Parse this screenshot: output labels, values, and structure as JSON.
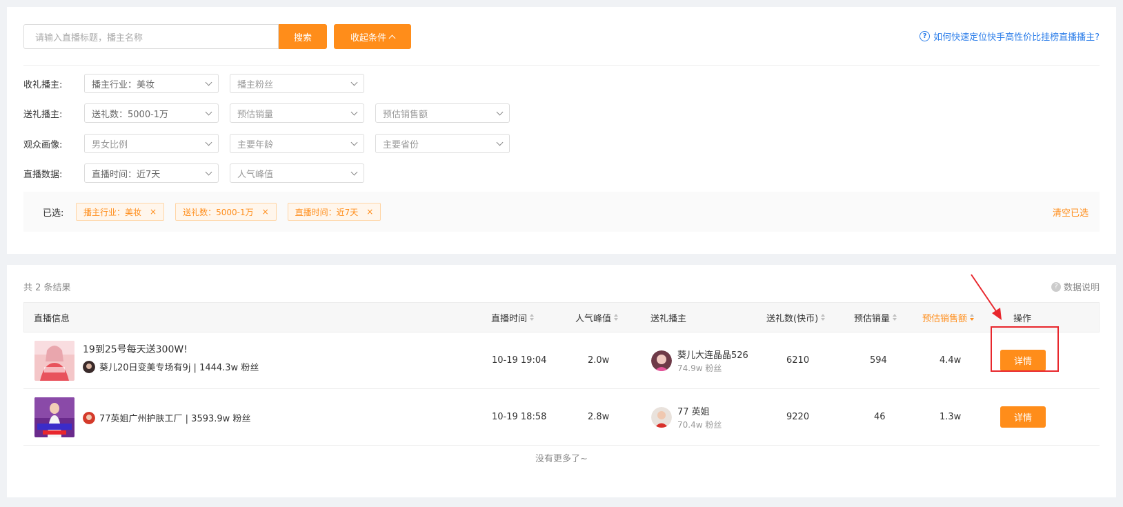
{
  "search": {
    "placeholder": "请输入直播标题，播主名称",
    "search_label": "搜索",
    "collapse_label": "收起条件"
  },
  "help": {
    "link_text": "如何快速定位快手高性价比挂榜直播播主?"
  },
  "filters": [
    {
      "label": "收礼播主:",
      "selects": [
        {
          "text": "播主行业：美妆",
          "active": true
        },
        {
          "text": "播主粉丝",
          "active": false
        }
      ]
    },
    {
      "label": "送礼播主:",
      "selects": [
        {
          "text": "送礼数：5000-1万",
          "active": true
        },
        {
          "text": "预估销量",
          "active": false
        },
        {
          "text": "预估销售额",
          "active": false
        }
      ]
    },
    {
      "label": "观众画像:",
      "selects": [
        {
          "text": "男女比例",
          "active": false
        },
        {
          "text": "主要年龄",
          "active": false
        },
        {
          "text": "主要省份",
          "active": false
        }
      ]
    },
    {
      "label": "直播数据:",
      "selects": [
        {
          "text": "直播时间：近7天",
          "active": true
        },
        {
          "text": "人气峰值",
          "active": false
        }
      ]
    }
  ],
  "selected": {
    "label": "已选:",
    "tags": [
      "播主行业：美妆",
      "送礼数：5000-1万",
      "直播时间：近7天"
    ],
    "remove_glyph": "×",
    "clear_label": "清空已选"
  },
  "results": {
    "count_text": "共 2 条结果",
    "data_note": "数据说明",
    "columns": {
      "info": "直播信息",
      "time": "直播时间",
      "peak": "人气峰值",
      "gifter": "送礼播主",
      "gifts": "送礼数(快币)",
      "sales": "预估销量",
      "revenue": "预估销售额",
      "action": "操作"
    },
    "rows": [
      {
        "title": "19到25号每天送300W!",
        "anchor": "葵儿20日变美专场有9j | 1444.3w 粉丝",
        "time": "10-19 19:04",
        "peak": "2.0w",
        "gifter_name": "葵儿大连晶晶526",
        "gifter_fans": "74.9w 粉丝",
        "gifts": "6210",
        "sales": "594",
        "revenue": "4.4w",
        "action": "详情"
      },
      {
        "title": "",
        "anchor": "77英姐广州护肤工厂 | 3593.9w 粉丝",
        "time": "10-19 18:58",
        "peak": "2.8w",
        "gifter_name": "77 英姐",
        "gifter_fans": "70.4w 粉丝",
        "gifts": "9220",
        "sales": "46",
        "revenue": "1.3w",
        "action": "详情"
      }
    ],
    "no_more": "没有更多了~"
  },
  "colors": {
    "accent": "#ff8d1a",
    "link": "#2b7de9",
    "highlight": "#e8262c"
  }
}
